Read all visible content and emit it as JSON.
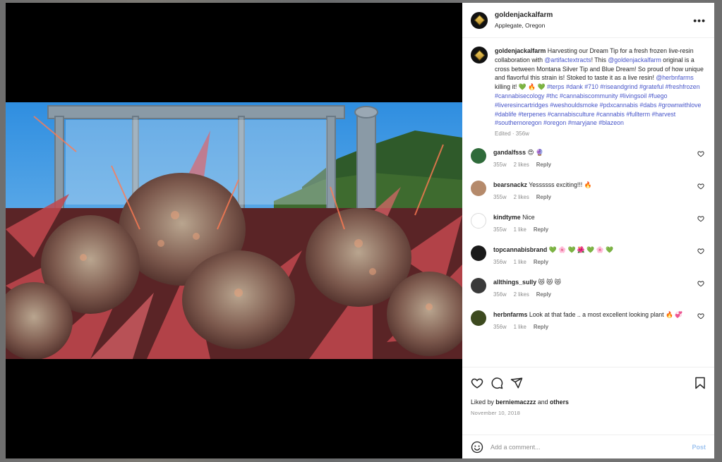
{
  "post": {
    "username": "goldenjackalfarm",
    "location": "Applegate, Oregon",
    "more_label": "•••",
    "caption": {
      "username": "goldenjackalfarm",
      "text_1": " Harvesting our Dream Tip for a fresh frozen live-resin collaboration with ",
      "mention_1": "@artifactextracts",
      "text_2": "! This ",
      "mention_2": "@goldenjackalfarm",
      "text_3": " original is a cross between Montana Silver Tip and Blue Dream! So proud of how unique and flavorful this strain is! Stoked to taste it as a live resin! ",
      "mention_3": "@herbnfarms",
      "text_4": " killing it! 💚 🔥 💚 ",
      "hashtags": "#terps #dank #710 #riseandgrind #grateful #freshfrozen #cannabisecology #thc #cannabiscommunity #livingsoil #fuego #liveresincartridges #weshouldsmoke #pdxcannabis #dabs #grownwithlove #dablife #terpenes #cannabisculture #cannabis #fullterm #harvest #southernoregon #oregon #maryjane #blazeon",
      "meta": "Edited · 356w"
    },
    "comments": [
      {
        "user": "gandalfsss",
        "text": "😍 🔮",
        "age": "355w",
        "likes": "2 likes",
        "reply": "Reply",
        "avatar_color": "#2f6b3a"
      },
      {
        "user": "bearsnackz",
        "text": "Yessssss exciting!!! 🔥",
        "age": "355w",
        "likes": "2 likes",
        "reply": "Reply",
        "avatar_color": "#b58a6b"
      },
      {
        "user": "kindtyme",
        "text": "Nice",
        "age": "355w",
        "likes": "1 like",
        "reply": "Reply",
        "avatar_color": "#ffffff"
      },
      {
        "user": "topcannabisbrand",
        "text": "💚 🌸 💚 🌺 💚 🌸 💚",
        "age": "356w",
        "likes": "1 like",
        "reply": "Reply",
        "avatar_color": "#1a1a1a"
      },
      {
        "user": "allthings_sully",
        "text": "😻 😻 😻",
        "age": "356w",
        "likes": "2 likes",
        "reply": "Reply",
        "avatar_color": "#3a3a3a"
      },
      {
        "user": "herbnfarms",
        "text": "Look at that fade .. a most excellent looking plant 🔥 💞",
        "age": "356w",
        "likes": "1 like",
        "reply": "Reply",
        "avatar_color": "#3d4a1f"
      }
    ],
    "liked_by_prefix": "Liked by ",
    "liked_by_user": "berniemaczzz",
    "liked_by_and": " and ",
    "liked_by_others": "others",
    "date": "November 10, 2018",
    "composer": {
      "placeholder": "Add a comment...",
      "post_label": "Post"
    }
  },
  "icons": [
    "heart-icon",
    "comment-icon",
    "share-icon",
    "bookmark-icon",
    "emoji-icon",
    "more-icon"
  ]
}
